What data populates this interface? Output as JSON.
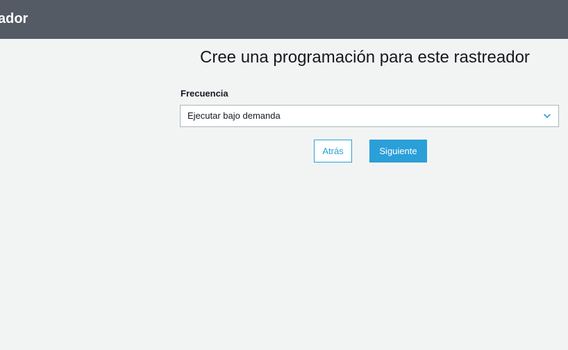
{
  "header": {
    "title": "ador"
  },
  "main": {
    "page_title": "Cree una programación para este rastreador",
    "frequency": {
      "label": "Frecuencia",
      "selected": "Ejecutar bajo demanda",
      "icon": "chevron-down-icon"
    },
    "buttons": {
      "back_label": "Atrás",
      "next_label": "Siguiente"
    }
  },
  "colors": {
    "header_bg": "#545b64",
    "page_bg": "#f2f4f4",
    "accent": "#2a9fd8"
  }
}
